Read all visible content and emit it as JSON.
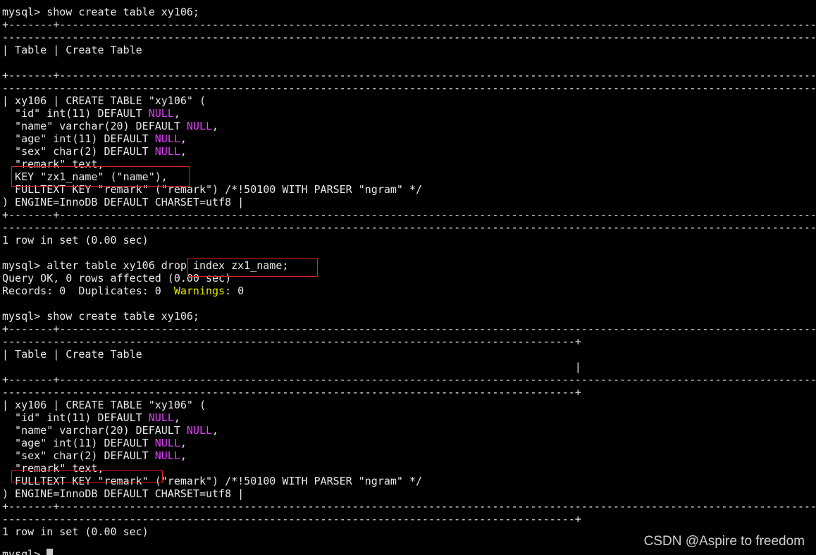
{
  "terminal": {
    "title": "",
    "colors": {
      "background": "#000000",
      "foreground": "#e8e8e8",
      "null_keyword": "#e040fb",
      "warnings_keyword": "#e6e600",
      "highlight_box": "#e02020"
    },
    "block1": {
      "prompt": "mysql> show create table xy106;",
      "sep_a": "+-------+----------------------------------------------------------------------------------------------------------------------------------------------",
      "sep_b": "----------------------------------------------------------------------------------------------------------------------------------------------",
      "header": "| Table | Create Table",
      "sep_c": "+-------+----------------------------------------------------------------------------------------------------------------------------------------------",
      "sep_d": "----------------------------------------------------------------------------------------------------------------------------------------------",
      "row_first": "| xy106 | CREATE TABLE \"xy106\" (",
      "col_id": "  \"id\" int(11) DEFAULT ",
      "col_name": "  \"name\" varchar(20) DEFAULT ",
      "col_age": "  \"age\" int(11) DEFAULT ",
      "col_sex": "  \"sex\" char(2) DEFAULT ",
      "col_remark": "  \"remark\" text,",
      "key_line": "  KEY \"zx1_name\" (\"name\"),",
      "fulltext": "  FULLTEXT KEY \"remark\" (\"remark\") /*!50100 WITH PARSER \"ngram\" */",
      "engine": ") ENGINE=InnoDB DEFAULT CHARSET=utf8 |",
      "sep_e": "+-------+----------------------------------------------------------------------------------------------------------------------------------------------",
      "sep_f": "----------------------------------------------------------------------------------------------------------------------------------------------",
      "rowcount": "1 row in set (0.00 sec)"
    },
    "null_word": "NULL",
    "null_suffix": ",",
    "alter": {
      "prompt": "mysql> alter table xy106 drop index zx1_name;",
      "ok": "Query OK, 0 rows affected (0.00 sec)",
      "records_prefix": "Records: 0  Duplicates: 0  ",
      "warnings_label": "Warnings",
      "records_suffix": ": 0"
    },
    "block2": {
      "prompt": "mysql> show create table xy106;",
      "sep_a": "+-------+----------------------------------------------------------------------------------------------------------------------------------------------",
      "sep_b": "------------------------------------------------------------------------------------------+",
      "header": "| Table | Create Table",
      "header_end": "                                                                                          |",
      "sep_c": "+-------+----------------------------------------------------------------------------------------------------------------------------------------------",
      "sep_d": "------------------------------------------------------------------------------------------+",
      "row_first": "| xy106 | CREATE TABLE \"xy106\" (",
      "col_id": "  \"id\" int(11) DEFAULT ",
      "col_name": "  \"name\" varchar(20) DEFAULT ",
      "col_age": "  \"age\" int(11) DEFAULT ",
      "col_sex": "  \"sex\" char(2) DEFAULT ",
      "col_remark": "  \"remark\" text,",
      "fulltext": "  FULLTEXT KEY \"remark\" (\"remark\") /*!50100 WITH PARSER \"ngram\" */",
      "engine": ") ENGINE=InnoDB DEFAULT CHARSET=utf8 |",
      "sep_e": "+-------+----------------------------------------------------------------------------------------------------------------------------------------------",
      "sep_f": "------------------------------------------------------------------------------------------+",
      "rowcount": "1 row in set (0.00 sec)"
    },
    "last_prompt": "mysql> "
  },
  "watermark": "CSDN @Aspire to freedom"
}
